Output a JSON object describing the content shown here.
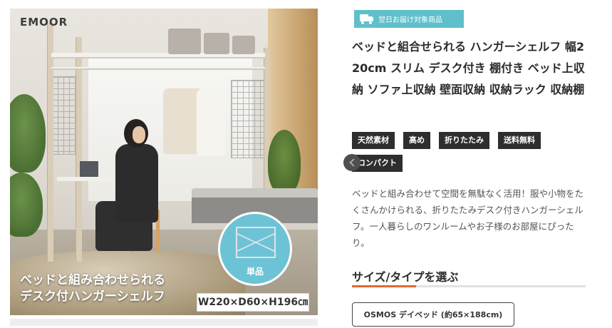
{
  "brand": {
    "logo_text": "EMOOR"
  },
  "image": {
    "caption_line1": "ベッドと組み合わせられる",
    "caption_line2": "デスク付ハンガーシェルフ",
    "dimensions": "W220×D60×H196㎝",
    "inset_label": "単品"
  },
  "delivery_badge": {
    "label": "翌日お届け対象商品",
    "icon": "truck-icon"
  },
  "product": {
    "title": "ベッドと組合せられる ハンガーシェルフ 幅220cm スリム デスク付き 棚付き ベッド上収納 ソファ上収納 壁面収納 収納ラック 収納棚",
    "tags": [
      "天然素材",
      "高め",
      "折りたたみ",
      "送料無料",
      "コンパクト"
    ],
    "description": "ベッドと組み合わせて空間を無駄なく活用！服や小物をたくさんかけられる、折りたたみデスク付きハンガーシェルフ。一人暮らしのワンルームやお子様のお部屋にぴったり。"
  },
  "options": {
    "section_title": "サイズ/タイプを選ぶ",
    "items": [
      "OSMOS デイベッド (約65×188cm)"
    ]
  },
  "colors": {
    "delivery_badge_bg": "#5fbfcb",
    "tag_bg": "#2e2e2e",
    "section_accent": "#e06a2e",
    "inset_circle": "#6dc3d6"
  }
}
